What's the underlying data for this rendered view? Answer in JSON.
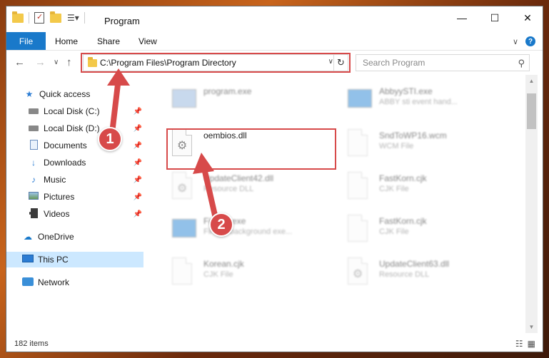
{
  "window": {
    "title": "Program",
    "minimize_icon": "—",
    "maximize_icon": "☐",
    "close_icon": "✕"
  },
  "ribbon": {
    "file_label": "File",
    "tabs": [
      "Home",
      "Share",
      "View"
    ],
    "chevron": "∨",
    "help": "?"
  },
  "nav": {
    "back": "←",
    "forward": "→",
    "recent": "∨",
    "up": "↑"
  },
  "address": {
    "path": "C:\\Program Files\\Program Directory",
    "dropdown": "∨",
    "refresh": "↻"
  },
  "search": {
    "placeholder": "Search Program",
    "icon": "⚲"
  },
  "sidebar": {
    "items": [
      {
        "label": "Quick access",
        "icon": "star-icon"
      },
      {
        "label": "Local Disk (C:)",
        "icon": "drive-icon",
        "pinned": true
      },
      {
        "label": "Local Disk (D:)",
        "icon": "drive-icon",
        "pinned": true
      },
      {
        "label": "Documents",
        "icon": "documents-icon",
        "pinned": true
      },
      {
        "label": "Downloads",
        "icon": "download-icon",
        "pinned": true
      },
      {
        "label": "Music",
        "icon": "music-icon",
        "pinned": true
      },
      {
        "label": "Pictures",
        "icon": "pictures-icon",
        "pinned": true
      },
      {
        "label": "Videos",
        "icon": "videos-icon",
        "pinned": true
      },
      {
        "label": "OneDrive",
        "icon": "cloud-icon"
      },
      {
        "label": "This PC",
        "icon": "computer-icon",
        "selected": true
      },
      {
        "label": "Network",
        "icon": "network-icon"
      }
    ],
    "pin_glyph": "📌"
  },
  "files": [
    {
      "name": "program.exe",
      "type": "",
      "icon": "exe-icon"
    },
    {
      "name": "AbbyySTI.exe",
      "type": "ABBY sti event hand...",
      "icon": "exe-icon"
    },
    {
      "name": "oembios.dll",
      "type": "",
      "icon": "dll-icon"
    },
    {
      "name": "SndToWP16.wcm",
      "type": "WCM File",
      "icon": "file-icon"
    },
    {
      "name": "UpdateClient42.dll",
      "type": "Resource DLL",
      "icon": "dll-icon"
    },
    {
      "name": "FastKorn.cjk",
      "type": "CJK File",
      "icon": "file-icon"
    },
    {
      "name": "Firefox.exe",
      "type": "Firefox background exe...",
      "icon": "exe-icon"
    },
    {
      "name": "FastKorn.cjk",
      "type": "CJK File",
      "icon": "file-icon"
    },
    {
      "name": "Korean.cjk",
      "type": "CJK File",
      "icon": "file-icon"
    },
    {
      "name": "UpdateClient63.dll",
      "type": "Resource DLL",
      "icon": "dll-icon"
    }
  ],
  "status": {
    "count": "182 items",
    "details_view": "☷",
    "tiles_view": "▦"
  },
  "callouts": [
    "1",
    "2"
  ],
  "colors": {
    "accent": "#1979ca",
    "highlight": "#d74a4a",
    "selected": "#cce8ff"
  }
}
